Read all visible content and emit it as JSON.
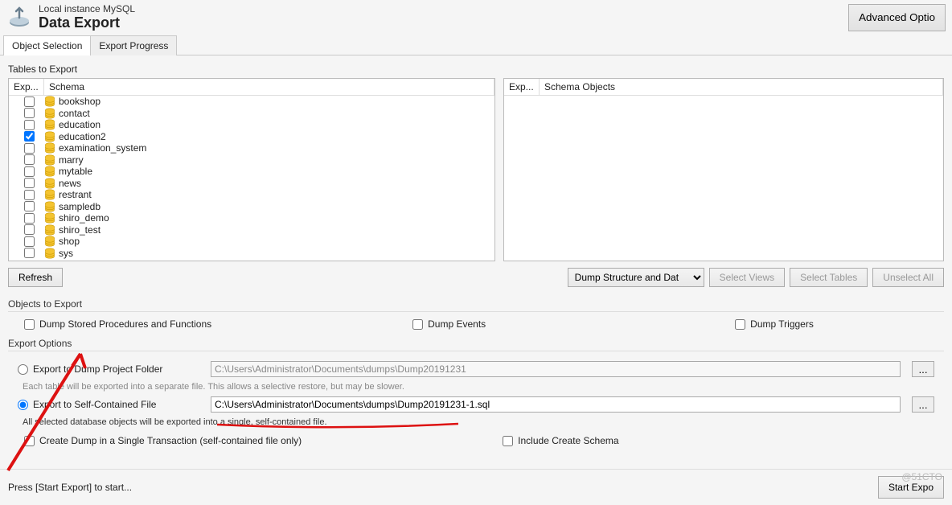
{
  "header": {
    "subtitle": "Local instance MySQL",
    "title": "Data Export",
    "advanced": "Advanced Optio"
  },
  "tabs": {
    "obj": "Object Selection",
    "progress": "Export Progress"
  },
  "tables_to_export": "Tables to Export",
  "left_cols": {
    "exp": "Exp...",
    "schema": "Schema"
  },
  "right_cols": {
    "exp": "Exp...",
    "schema": "Schema Objects"
  },
  "schemas": [
    {
      "name": "bookshop",
      "checked": false
    },
    {
      "name": "contact",
      "checked": false
    },
    {
      "name": "education",
      "checked": false
    },
    {
      "name": "education2",
      "checked": true
    },
    {
      "name": "examination_system",
      "checked": false
    },
    {
      "name": "marry",
      "checked": false
    },
    {
      "name": "mytable",
      "checked": false
    },
    {
      "name": "news",
      "checked": false
    },
    {
      "name": "restrant",
      "checked": false
    },
    {
      "name": "sampledb",
      "checked": false
    },
    {
      "name": "shiro_demo",
      "checked": false
    },
    {
      "name": "shiro_test",
      "checked": false
    },
    {
      "name": "shop",
      "checked": false
    },
    {
      "name": "sys",
      "checked": false
    }
  ],
  "refresh": "Refresh",
  "dump_select": "Dump Structure and Dat",
  "select_views": "Select Views",
  "select_tables": "Select Tables",
  "unselect_all": "Unselect All",
  "objects_to_export": "Objects to Export",
  "dump_sp": "Dump Stored Procedures and Functions",
  "dump_events": "Dump Events",
  "dump_triggers": "Dump Triggers",
  "export_options": "Export Options",
  "radio1": "Export to Dump Project Folder",
  "path1": "C:\\Users\\Administrator\\Documents\\dumps\\Dump20191231",
  "hint1": "Each table will be exported into a separate file. This allows a selective restore, but may be slower.",
  "radio2": "Export to Self-Contained File",
  "path2": "C:\\Users\\Administrator\\Documents\\dumps\\Dump20191231-1.sql",
  "hint2": "All selected database objects will be exported into a single, self-contained file.",
  "single_tx": "Create Dump in a Single Transaction (self-contained file only)",
  "include_create": "Include Create Schema",
  "footer": "Press [Start Export] to start...",
  "start": "Start Expo",
  "browse": "...",
  "watermark": "@51CTO"
}
